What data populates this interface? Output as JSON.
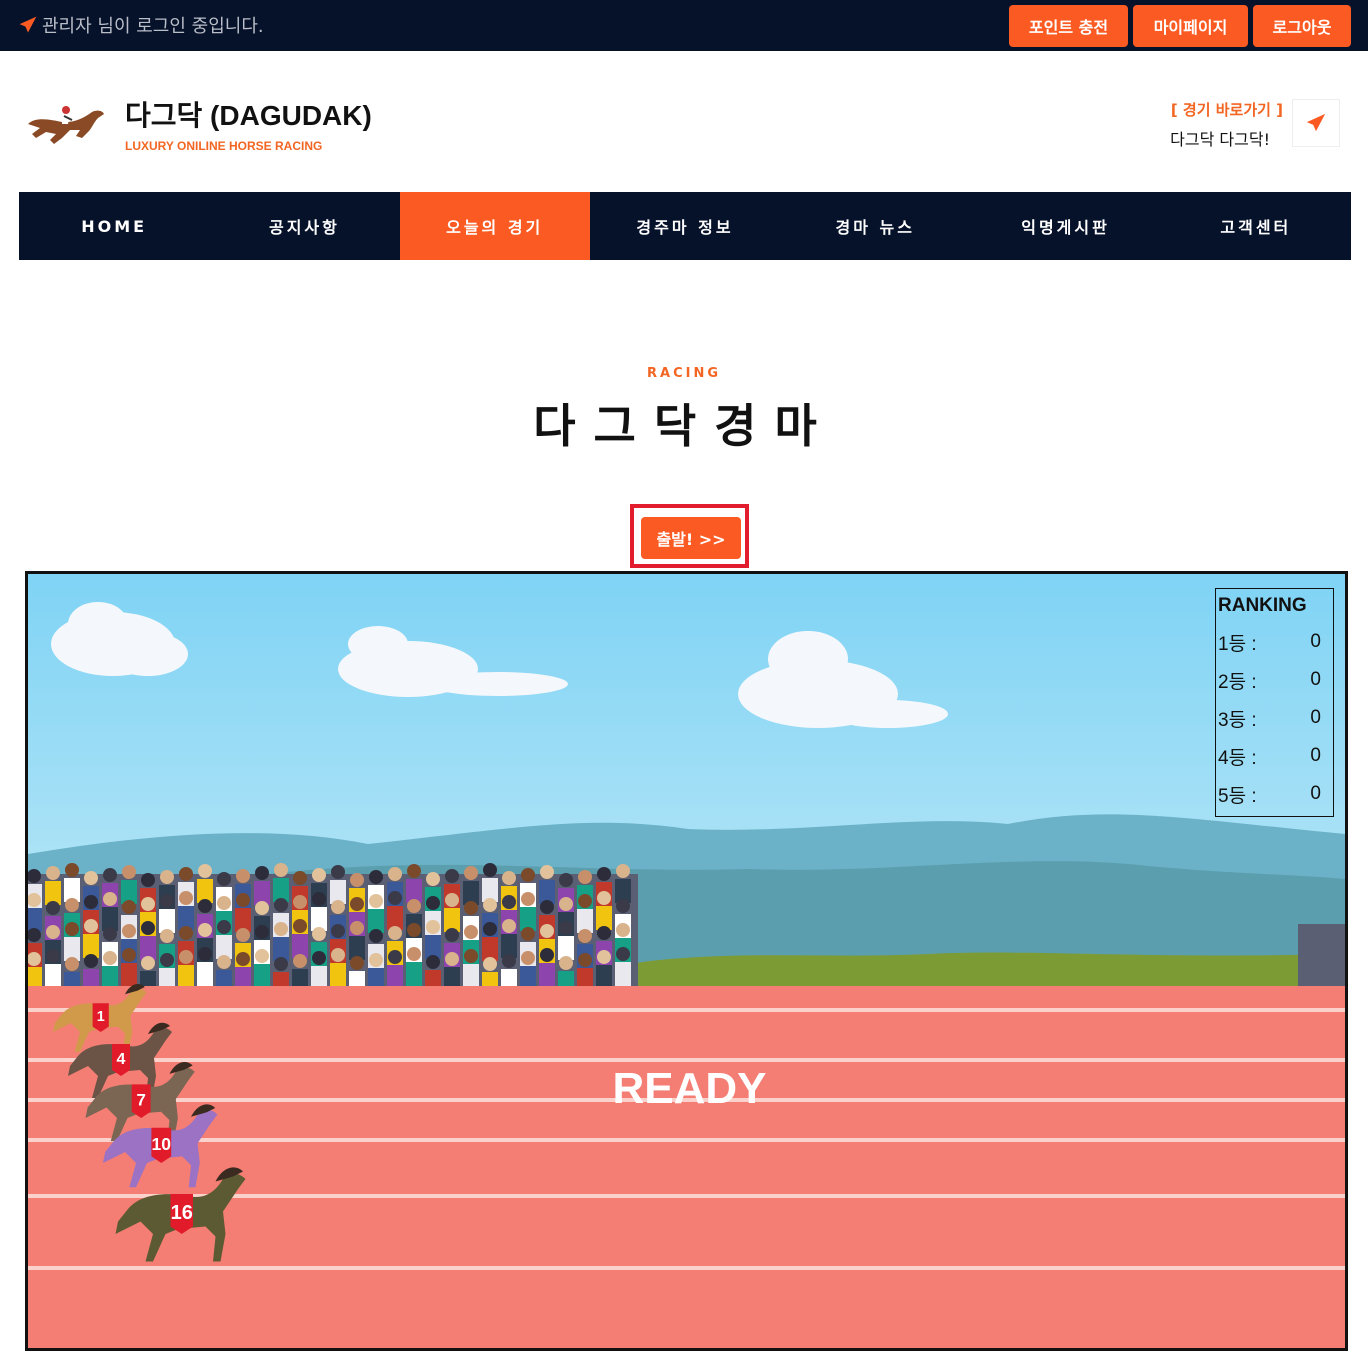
{
  "topbar": {
    "login_text": "관리자 님이 로그인 중입니다.",
    "buttons": [
      "포인트 충전",
      "마이페이지",
      "로그아웃"
    ]
  },
  "header": {
    "title": "다그닥 (DAGUDAK)",
    "subtitle": "LUXURY ONILINE HORSE RACING",
    "quick_link": "[ 경기 바로가기 ]",
    "quick_text": "다그닥 다그닥!"
  },
  "nav": {
    "items": [
      "HOME",
      "공지사항",
      "오늘의 경기",
      "경주마 정보",
      "경마 뉴스",
      "익명게시판",
      "고객센터"
    ],
    "active_index": 2
  },
  "section": {
    "label": "RACING",
    "title": "다그닥경마"
  },
  "start_button": "출발! >>",
  "race": {
    "status": "READY",
    "ranking_title": "RANKING",
    "ranking": [
      {
        "place": "1등 :",
        "value": "0"
      },
      {
        "place": "2등 :",
        "value": "0"
      },
      {
        "place": "3등 :",
        "value": "0"
      },
      {
        "place": "4등 :",
        "value": "0"
      },
      {
        "place": "5등 :",
        "value": "0"
      }
    ],
    "horses": [
      {
        "number": "1",
        "color": "#d19a4a"
      },
      {
        "number": "4",
        "color": "#6b5446"
      },
      {
        "number": "7",
        "color": "#7a6652"
      },
      {
        "number": "10",
        "color": "#9b72c4"
      },
      {
        "number": "16",
        "color": "#5c5a32"
      }
    ]
  },
  "colors": {
    "accent": "#fb5b23",
    "navy": "#06112a",
    "track": "#f47e74",
    "sky": "#87d4f2"
  }
}
